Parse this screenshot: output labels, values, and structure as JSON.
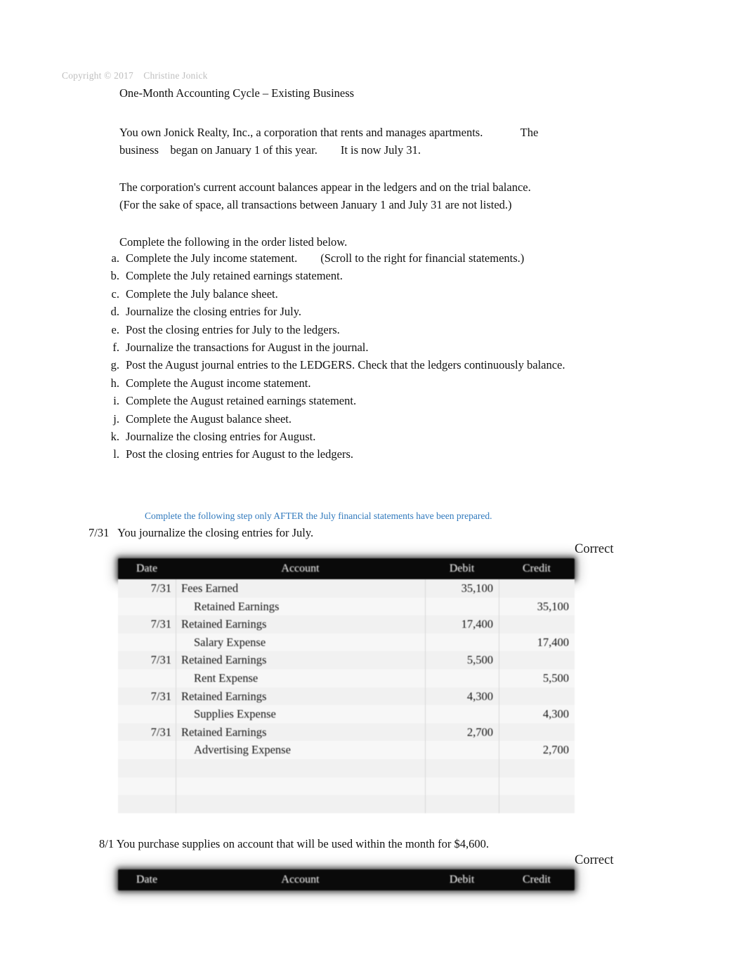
{
  "document": {
    "copyright": "Copyright © 2017    Christine Jonick",
    "title": "One-Month Accounting Cycle – Existing Business",
    "intro_paragraph": "You own Jonick Realty, Inc., a corporation that rents and manages apartments.             The\nbusiness    began on January 1 of this year.        It is now July 31.",
    "balances_paragraph": "The corporation's current account balances appear in the ledgers and on the trial balance.\n(For the sake of space, all transactions between January 1 and July 31 are not listed.)",
    "order_instruction": "Complete the following in the order listed below."
  },
  "task_list": [
    {
      "marker": "a.",
      "text": "Complete the July income statement.        (Scroll to the right for financial statements.)"
    },
    {
      "marker": "b.",
      "text": "Complete the July retained earnings statement."
    },
    {
      "marker": "c.",
      "text": "Complete the July balance sheet."
    },
    {
      "marker": "d.",
      "text": "Journalize the closing entries for July."
    },
    {
      "marker": "e.",
      "text": "Post the closing entries for July to the ledgers."
    },
    {
      "marker": "f.",
      "text": "Journalize the transactions for August in the journal."
    },
    {
      "marker": "g.",
      "text": "Post the August journal entries to the LEDGERS. Check that the ledgers continuously balance."
    },
    {
      "marker": "h.",
      "text": "Complete the August income statement."
    },
    {
      "marker": "i.",
      "text": "Complete the August retained earnings statement."
    },
    {
      "marker": "j.",
      "text": "Complete the August balance sheet."
    },
    {
      "marker": "k.",
      "text": "Journalize the closing entries for August."
    },
    {
      "marker": "l.",
      "text": "Post the closing entries for August to the ledgers."
    }
  ],
  "blue_note": "Complete the following step only AFTER the July financial statements have been prepared.",
  "july_section": {
    "prompt": "7/31   You journalize the closing entries for July.",
    "status_badge": "Correct",
    "columns": {
      "date": "Date",
      "account": "Account",
      "debit": "Debit",
      "credit": "Credit"
    },
    "rows": [
      {
        "date": "7/31",
        "account": "Fees Earned",
        "indent": false,
        "debit": "35,100",
        "credit": ""
      },
      {
        "date": "",
        "account": "Retained Earnings",
        "indent": true,
        "debit": "",
        "credit": "35,100"
      },
      {
        "date": "7/31",
        "account": "Retained Earnings",
        "indent": false,
        "debit": "17,400",
        "credit": ""
      },
      {
        "date": "",
        "account": "Salary Expense",
        "indent": true,
        "debit": "",
        "credit": "17,400"
      },
      {
        "date": "7/31",
        "account": "Retained Earnings",
        "indent": false,
        "debit": "5,500",
        "credit": ""
      },
      {
        "date": "",
        "account": "Rent Expense",
        "indent": true,
        "debit": "",
        "credit": "5,500"
      },
      {
        "date": "7/31",
        "account": "Retained Earnings",
        "indent": false,
        "debit": "4,300",
        "credit": ""
      },
      {
        "date": "",
        "account": "Supplies Expense",
        "indent": true,
        "debit": "",
        "credit": "4,300"
      },
      {
        "date": "7/31",
        "account": "Retained Earnings",
        "indent": false,
        "debit": "2,700",
        "credit": ""
      },
      {
        "date": "",
        "account": "Advertising Expense",
        "indent": true,
        "debit": "",
        "credit": "2,700"
      },
      {
        "date": "",
        "account": "",
        "indent": false,
        "debit": "",
        "credit": ""
      },
      {
        "date": "",
        "account": "",
        "indent": false,
        "debit": "",
        "credit": ""
      },
      {
        "date": "",
        "account": "",
        "indent": false,
        "debit": "",
        "credit": ""
      }
    ]
  },
  "august_section": {
    "prompt": "8/1 You purchase supplies on account that will be used within the month for $4,600.",
    "status_badge": "Correct",
    "columns": {
      "date": "Date",
      "account": "Account",
      "debit": "Debit",
      "credit": "Credit"
    },
    "rows": []
  },
  "colors": {
    "blue_note": "#3079bd",
    "copyright_gray": "#bfbfbf",
    "header_bar": "#0a0a0a",
    "row_light": "#f7f7f7",
    "row_alt": "#f1f1f1"
  }
}
